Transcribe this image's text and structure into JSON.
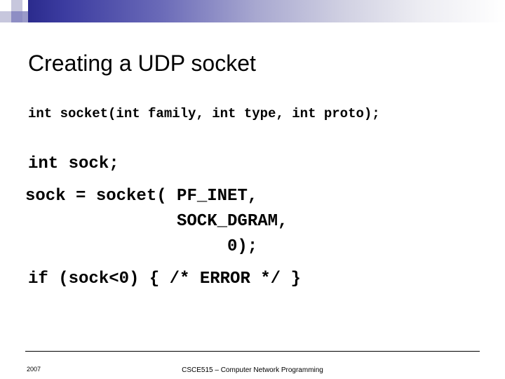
{
  "slide": {
    "title": "Creating a UDP socket",
    "code": {
      "prototype": "int socket(int family, int type, int proto);",
      "declare": "int sock;",
      "call_line1": "sock = socket( PF_INET,",
      "call_line2": "SOCK_DGRAM,",
      "call_line3": "0);",
      "error_check": "if (sock<0) { /* ERROR */ }"
    },
    "footer": {
      "year": "2007",
      "course": "CSCE515 – Computer Network Programming"
    },
    "colors": {
      "band_start": "#2a2a8c",
      "band_end": "#ffffff",
      "text": "#000000",
      "background": "#ffffff"
    }
  }
}
